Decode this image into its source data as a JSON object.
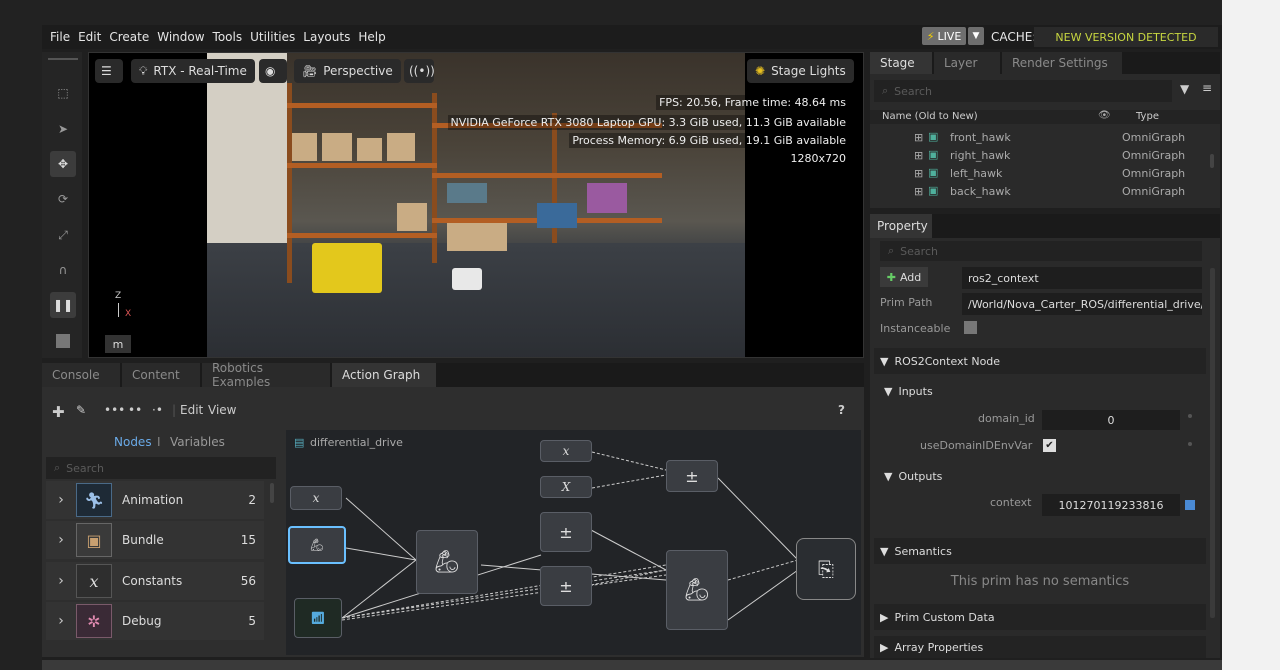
{
  "menubar": {
    "items": [
      "File",
      "Edit",
      "Create",
      "Window",
      "Tools",
      "Utilities",
      "Layouts",
      "Help"
    ],
    "live_label": "LIVE",
    "cache_label": "CACHE:",
    "cache_status": "NEW VERSION DETECTED",
    "cache_status_color": "#c8d740"
  },
  "viewport": {
    "renderer": "RTX - Real-Time",
    "camera": "Perspective",
    "lights": "Stage Lights",
    "stats": [
      "FPS: 20.56, Frame time: 48.64 ms",
      "NVIDIA GeForce RTX 3080 Laptop GPU: 3.3 GiB used, 11.3 GiB available",
      "Process Memory: 6.9 GiB used, 19.1 GiB available",
      "1280x720"
    ],
    "unit_label": "m",
    "axis_z": "Z",
    "axis_x": "X"
  },
  "bottom_tabs": [
    "Console",
    "Content",
    "Robotics Examples",
    "Action Graph"
  ],
  "action_graph": {
    "menu_edit": "Edit",
    "menu_view": "View",
    "help": "?",
    "nodes_tab": "Nodes",
    "separator": "I",
    "variables_tab": "Variables",
    "search_placeholder": "Search",
    "graph_name": "differential_drive",
    "categories": [
      {
        "label": "Animation",
        "count": "2",
        "icon": "running-figure-icon"
      },
      {
        "label": "Bundle",
        "count": "15",
        "icon": "box-icon"
      },
      {
        "label": "Constants",
        "count": "56",
        "icon": "x-variable-icon"
      },
      {
        "label": "Debug",
        "count": "5",
        "icon": "bug-icon"
      }
    ],
    "node_x": "x",
    "node_x_upper": "X"
  },
  "stage": {
    "tabs": [
      "Stage",
      "Layer",
      "Render Settings"
    ],
    "search_placeholder": "Search",
    "col_name": "Name (Old to New)",
    "col_type": "Type",
    "rows": [
      {
        "name": "front_hawk",
        "type": "OmniGraph"
      },
      {
        "name": "right_hawk",
        "type": "OmniGraph"
      },
      {
        "name": "left_hawk",
        "type": "OmniGraph"
      },
      {
        "name": "back_hawk",
        "type": "OmniGraph"
      }
    ]
  },
  "property": {
    "tab": "Property",
    "search_placeholder": "Search",
    "add_label": "Add",
    "prim_name": "ros2_context",
    "prim_path_label": "Prim Path",
    "prim_path": "/World/Nova_Carter_ROS/differential_drive/r",
    "instanceable_label": "Instanceable",
    "node_section": "ROS2Context Node",
    "inputs_label": "Inputs",
    "domain_id_label": "domain_id",
    "domain_id_value": "0",
    "use_domain_label": "useDomainIDEnvVar",
    "outputs_label": "Outputs",
    "context_label": "context",
    "context_value": "101270119233816",
    "semantics_label": "Semantics",
    "semantics_empty": "This prim has no semantics",
    "custom_data_label": "Prim Custom Data",
    "array_props_label": "Array Properties"
  }
}
